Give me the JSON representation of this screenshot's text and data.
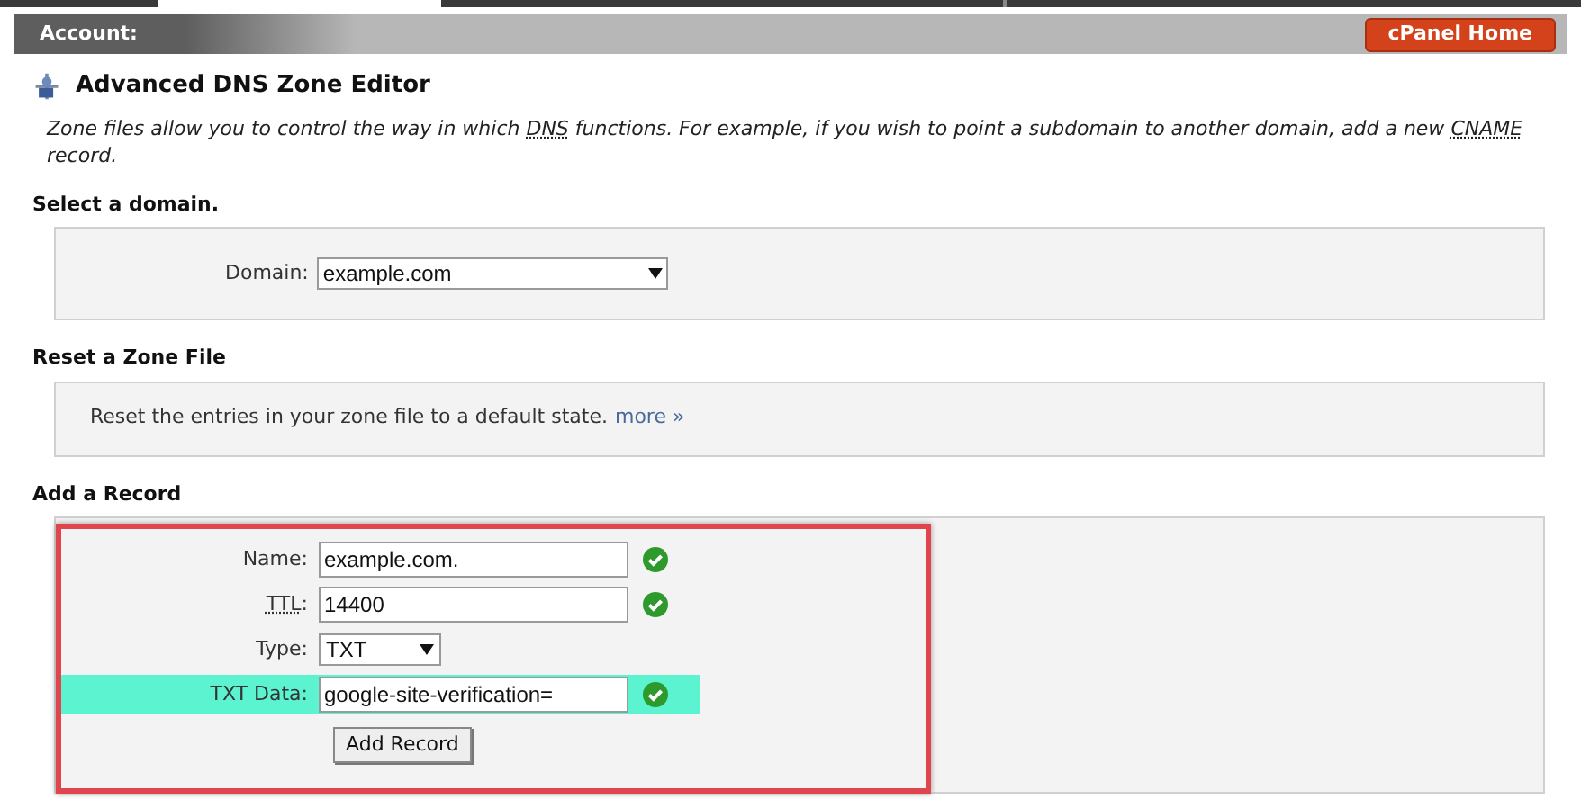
{
  "header": {
    "account_label": "Account:",
    "home_button": "cPanel Home"
  },
  "title": "Advanced DNS Zone Editor",
  "description": [
    {
      "kind": "plain",
      "text": "Zone files allow you to control the way in which "
    },
    {
      "kind": "abbr",
      "text": "DNS"
    },
    {
      "kind": "plain",
      "text": " functions. For example, if you wish to point a subdomain to another domain, add a new "
    },
    {
      "kind": "abbr",
      "text": "CNAME"
    },
    {
      "kind": "plain",
      "text": " record."
    }
  ],
  "select_domain": {
    "heading": "Select a domain.",
    "label": "Domain:",
    "value": "example.com"
  },
  "reset_zone": {
    "heading": "Reset a Zone File",
    "text": "Reset the entries in your zone file to a default state.",
    "link": "more »"
  },
  "add_record": {
    "heading": "Add a Record",
    "outlined": true,
    "fields": [
      {
        "kind": "text",
        "label": [
          {
            "kind": "plain",
            "text": "Name:"
          }
        ],
        "value": "example.com.",
        "highlighted": false,
        "valid": true
      },
      {
        "kind": "text",
        "label": [
          {
            "kind": "abbr",
            "text": "TTL"
          },
          {
            "kind": "plain",
            "text": ":"
          }
        ],
        "value": "14400",
        "highlighted": false,
        "valid": true
      },
      {
        "kind": "select",
        "label": [
          {
            "kind": "plain",
            "text": "Type:"
          }
        ],
        "value": "TXT",
        "highlighted": false,
        "valid": false
      },
      {
        "kind": "text",
        "label": [
          {
            "kind": "plain",
            "text": "TXT Data:"
          }
        ],
        "value": "google-site-verification=",
        "highlighted": true,
        "valid": true
      }
    ],
    "button": "Add Record"
  }
}
